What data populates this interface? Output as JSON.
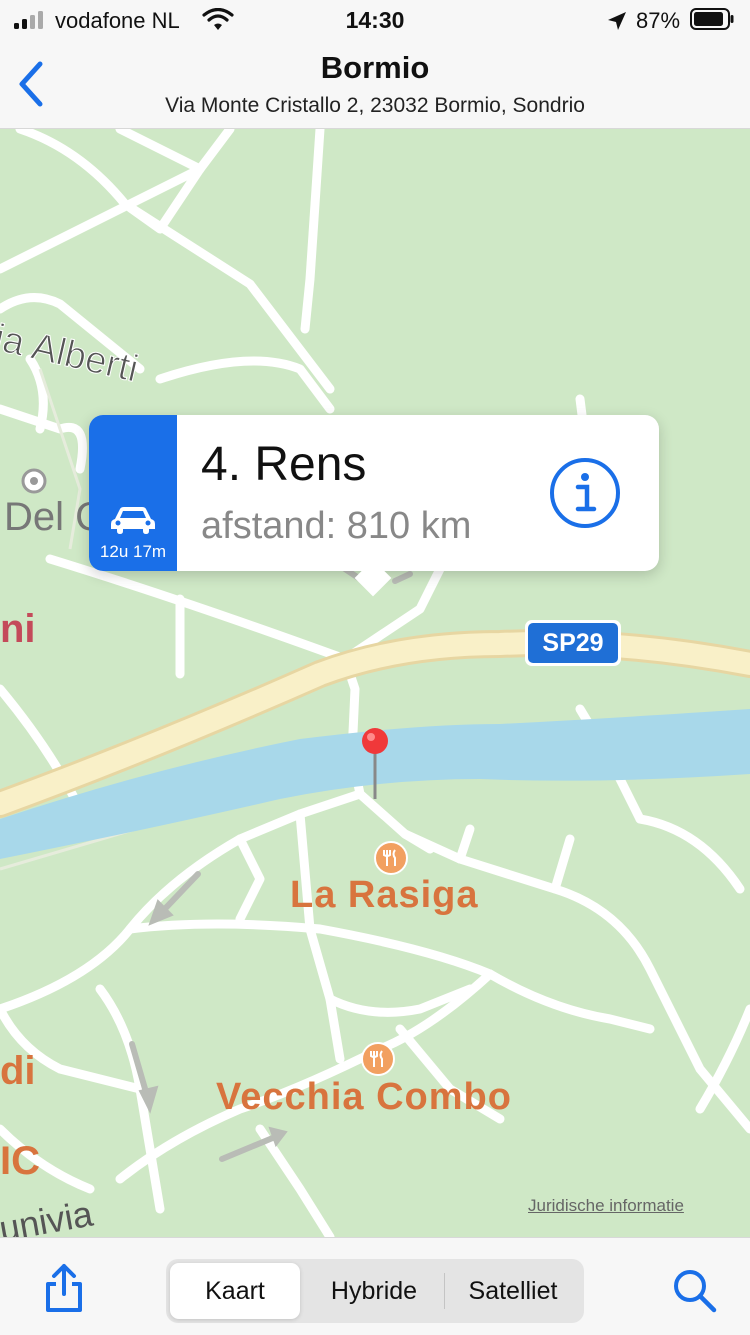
{
  "status": {
    "carrier": "vodafone NL",
    "time": "14:30",
    "battery": "87%"
  },
  "nav": {
    "title": "Bormio",
    "subtitle": "Via Monte Cristallo 2, 23032 Bormio, Sondrio"
  },
  "map": {
    "labels": {
      "alberti": "ia Alberti",
      "del": "Del C",
      "ni": "ni",
      "rasiga": "La Rasiga",
      "vecchia": "Vecchia Combo",
      "di": "di",
      "ic": "IC",
      "funivia": "univia"
    },
    "road_shield": "SP29",
    "legal": "Juridische informatie"
  },
  "callout": {
    "drive_time": "12u 17m",
    "title": "4. Rens",
    "distance": "afstand: 810 km"
  },
  "toolbar": {
    "segments": [
      "Kaart",
      "Hybride",
      "Satelliet"
    ],
    "selected": "Kaart"
  },
  "colors": {
    "accent": "#1a6fe8",
    "map_green": "#cfe8c6",
    "river": "#a8d8ea",
    "highway": "#f9f0c8",
    "poi_orange": "#d8743e"
  }
}
